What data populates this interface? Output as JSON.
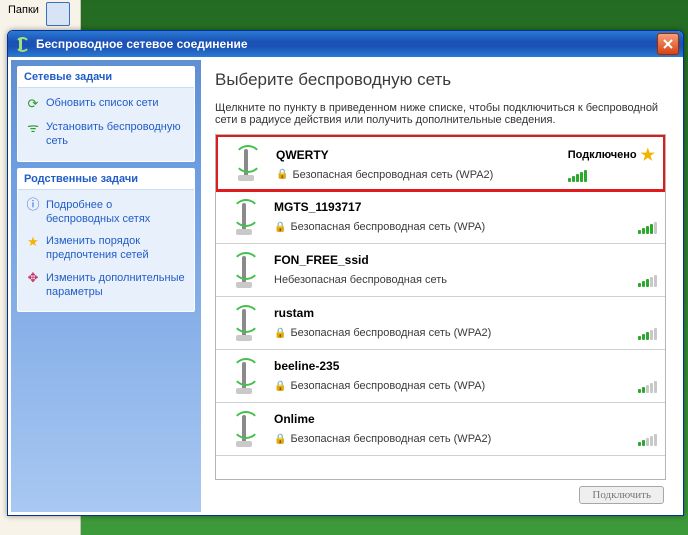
{
  "desktop": {
    "folder_label": "Папки"
  },
  "window": {
    "title": "Беспроводное сетевое соединение"
  },
  "sidebar": {
    "group1_title": "Сетевые задачи",
    "group1_items": [
      {
        "label": "Обновить список сети"
      },
      {
        "label": "Установить беспроводную сеть"
      }
    ],
    "group2_title": "Родственные задачи",
    "group2_items": [
      {
        "label": "Подробнее о беспроводных сетях"
      },
      {
        "label": "Изменить порядок предпочтения сетей"
      },
      {
        "label": "Изменить дополнительные параметры"
      }
    ]
  },
  "main": {
    "heading": "Выберите беспроводную сеть",
    "hint": "Щелкните по пункту в приведенном ниже списке, чтобы подключиться к беспроводной сети в радиусе действия или получить дополнительные сведения.",
    "connect_button": "Подключить"
  },
  "networks": [
    {
      "name": "QWERTY",
      "status": "Подключено",
      "secure": true,
      "sec_text": "Безопасная беспроводная сеть (WPA2)",
      "strength": 5,
      "highlight": true,
      "starred": true
    },
    {
      "name": "MGTS_1193717",
      "status": "",
      "secure": true,
      "sec_text": "Безопасная беспроводная сеть (WPA)",
      "strength": 4,
      "highlight": false,
      "starred": false
    },
    {
      "name": "FON_FREE_ssid",
      "status": "",
      "secure": false,
      "sec_text": "Небезопасная беспроводная сеть",
      "strength": 3,
      "highlight": false,
      "starred": false
    },
    {
      "name": "rustam",
      "status": "",
      "secure": true,
      "sec_text": "Безопасная беспроводная сеть (WPA2)",
      "strength": 3,
      "highlight": false,
      "starred": false
    },
    {
      "name": "beeline-235",
      "status": "",
      "secure": true,
      "sec_text": "Безопасная беспроводная сеть (WPA)",
      "strength": 2,
      "highlight": false,
      "starred": false
    },
    {
      "name": "Onlime",
      "status": "",
      "secure": true,
      "sec_text": "Безопасная беспроводная сеть (WPA2)",
      "strength": 2,
      "highlight": false,
      "starred": false
    }
  ]
}
